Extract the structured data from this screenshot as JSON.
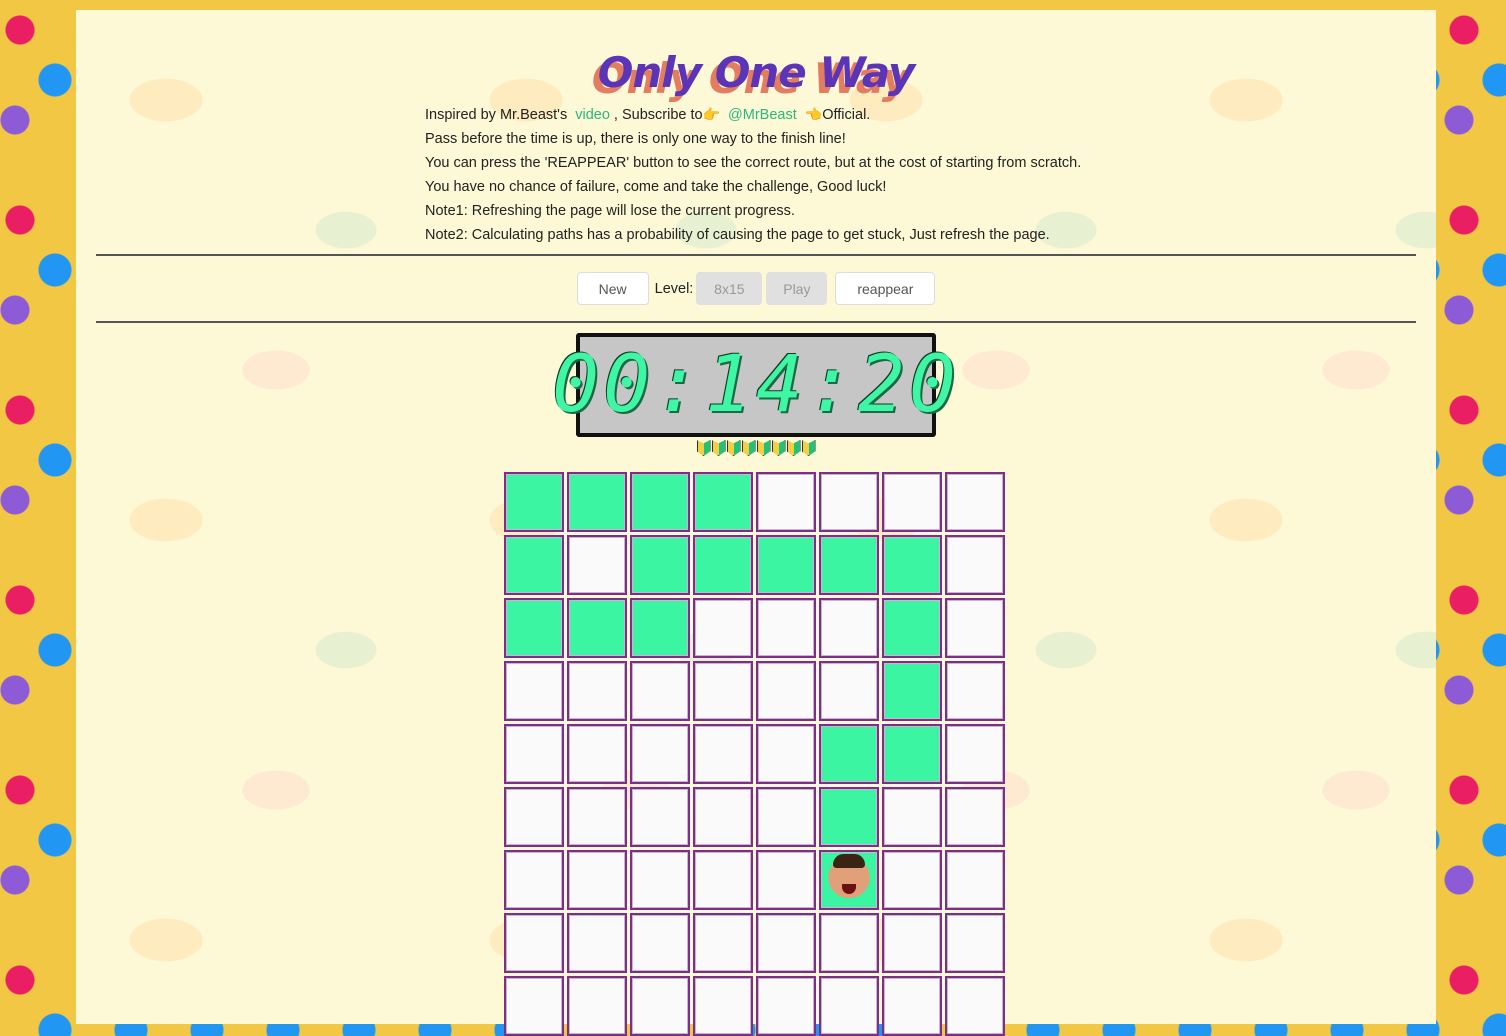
{
  "header": {
    "title": "Only One Way"
  },
  "intro": {
    "line1_prefix": "Inspired by Mr.Beast's",
    "video_link": "video",
    "line1_mid": ", Subscribe to",
    "channel_link": "@MrBeast",
    "line1_suffix": "Official.",
    "line2": "Pass before the time is up, there is only one way to the finish line!",
    "line3": "You can press the 'REAPPEAR' button to see the correct route, but at the cost of starting from scratch.",
    "line4": "You have no chance of failure, come and take the challenge, Good luck!",
    "line5": "Note1: Refreshing the page will lose the current progress.",
    "line6": "Note2: Calculating paths has a probability of causing the page to get stuck, Just refresh the page."
  },
  "controls": {
    "new_label": "New",
    "level_label": "Level:",
    "level_value": "8x15",
    "play_label": "Play",
    "reappear_label": "reappear"
  },
  "timer": {
    "value": "00:14:20"
  },
  "lives": {
    "count": 8
  },
  "board": {
    "columns": 8,
    "visible_rows": 9,
    "player_position": [
      6,
      5
    ],
    "highlighted_cells": [
      [
        0,
        0
      ],
      [
        0,
        1
      ],
      [
        0,
        2
      ],
      [
        0,
        3
      ],
      [
        1,
        0
      ],
      [
        1,
        2
      ],
      [
        1,
        3
      ],
      [
        1,
        4
      ],
      [
        1,
        5
      ],
      [
        1,
        6
      ],
      [
        2,
        0
      ],
      [
        2,
        1
      ],
      [
        2,
        2
      ],
      [
        2,
        6
      ],
      [
        3,
        6
      ],
      [
        4,
        5
      ],
      [
        4,
        6
      ],
      [
        5,
        5
      ]
    ]
  }
}
